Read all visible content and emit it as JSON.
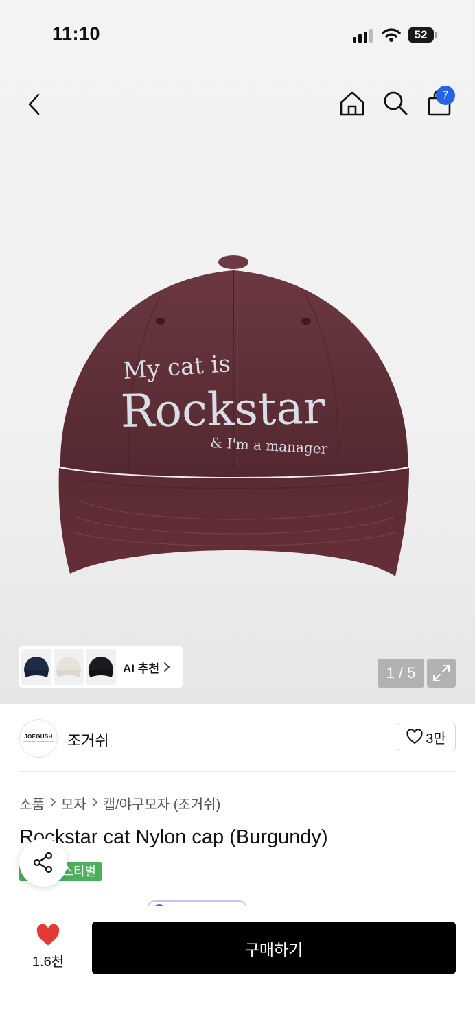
{
  "status_bar": {
    "time": "11:10",
    "battery": "52"
  },
  "header": {
    "cart_count": "7"
  },
  "gallery": {
    "ai_recommend_label": "AI 추천",
    "page_indicator": "1 / 5",
    "cap_text": {
      "line1": "My cat is",
      "line2": "Rockstar",
      "line3": "& I'm a manager"
    }
  },
  "brand": {
    "name": "조거쉬",
    "logo_text": "JOEGUSH",
    "logo_subtext": "WONDERFUL MIND SUPPLIES",
    "like_count": "3만"
  },
  "breadcrumb": [
    "소품",
    "모자",
    "캡/야구모자 (조거쉬)"
  ],
  "product": {
    "title": "Rockstar cat Nylon cap (Burgundy)",
    "badge": "스티벌"
  },
  "bottom_bar": {
    "wish_count": "1.6천",
    "buy_label": "구매하기"
  },
  "colors": {
    "accent_blue": "#2563eb",
    "cap_burgundy": "#5e2e35",
    "badge_green": "#4caf5a",
    "heart_red": "#e53935",
    "buy_button": "#000000"
  },
  "icons": [
    "back-chevron-icon",
    "home-icon",
    "search-icon",
    "shopping-bag-icon",
    "expand-icon",
    "heart-icon",
    "share-icon",
    "chevron-right-icon",
    "signal-icon",
    "wifi-icon",
    "battery-icon"
  ]
}
